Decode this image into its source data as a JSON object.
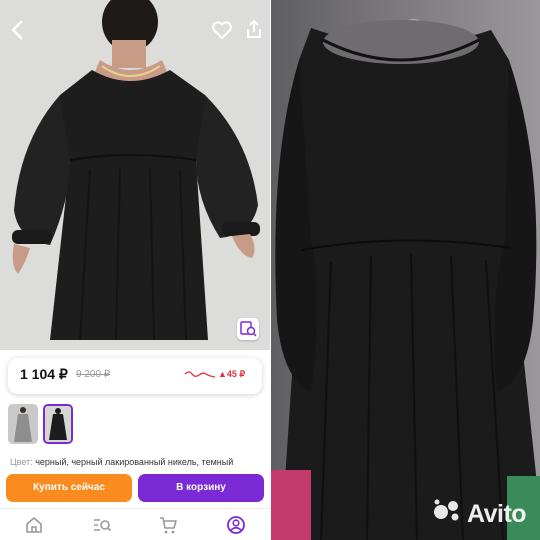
{
  "top_bar": {
    "back_icon": "chevron-left-icon",
    "favorite_icon": "heart-icon",
    "share_icon": "share-icon"
  },
  "product": {
    "price_current": "1 104 ₽",
    "price_old": "9 200 ₽",
    "price_change": "▲45 ₽",
    "color_label": "Цвет:",
    "color_value": "черный, черный лакированный никель, темный",
    "color_value_cont": "...ый ..."
  },
  "actions": {
    "buy_now": "Купить сейчас",
    "add_to_cart": "В корзину"
  },
  "bottom_nav": [
    "home-icon",
    "catalog-search-icon",
    "cart-icon",
    "profile-icon"
  ],
  "watermark": {
    "text": "Avito"
  },
  "colors": {
    "accent_purple": "#7b2bd6",
    "accent_orange": "#f98b1f",
    "price_drop_red": "#e0323c"
  }
}
